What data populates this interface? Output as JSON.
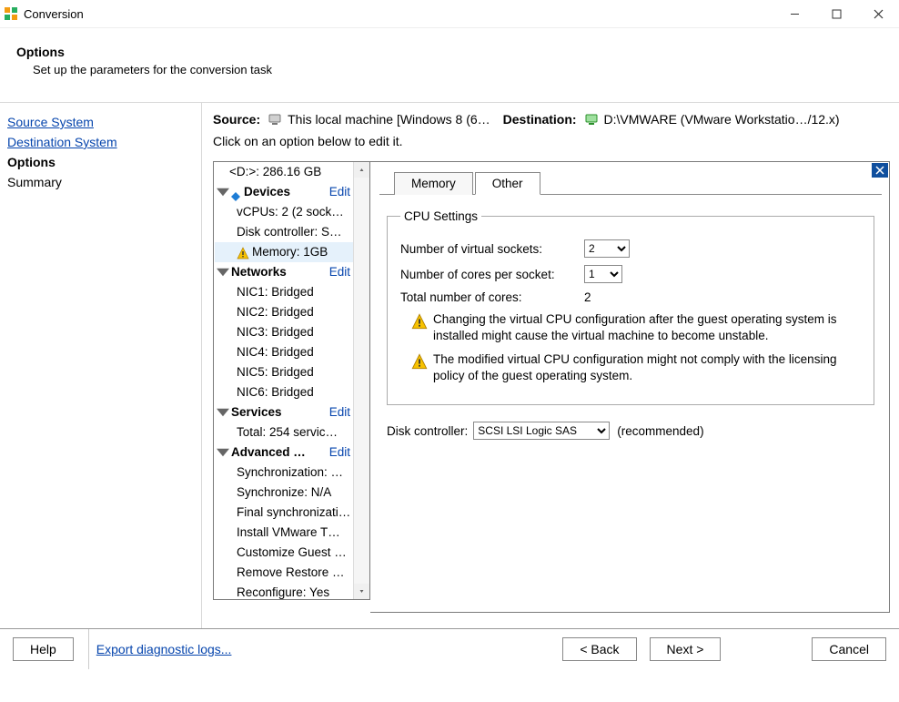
{
  "window": {
    "title": "Conversion"
  },
  "header": {
    "title": "Options",
    "subtitle": "Set up the parameters for the conversion task"
  },
  "wizard": {
    "source_link": "Source System",
    "dest_link": "Destination System",
    "options_label": "Options",
    "summary_label": "Summary"
  },
  "info": {
    "source_label": "Source:",
    "source_value": "This local machine [Windows 8 (6…",
    "dest_label": "Destination:",
    "dest_value": "D:\\VMWARE (VMware Workstatio…/12.x)",
    "instruction": "Click on an option below to edit it."
  },
  "tree": {
    "top_disk": "<D:>: 286.16 GB",
    "devices": {
      "label": "Devices",
      "edit": "Edit",
      "vcpus": "vCPUs: 2 (2 sock…",
      "disk_controller": "Disk controller: S…",
      "memory": "Memory: 1GB"
    },
    "networks": {
      "label": "Networks",
      "edit": "Edit",
      "items": [
        "NIC1: Bridged",
        "NIC2: Bridged",
        "NIC3: Bridged",
        "NIC4: Bridged",
        "NIC5: Bridged",
        "NIC6: Bridged"
      ]
    },
    "services": {
      "label": "Services",
      "edit": "Edit",
      "total": "Total: 254 servic…"
    },
    "advanced": {
      "label": "Advanced …",
      "edit": "Edit",
      "items": [
        "Synchronization: …",
        "Synchronize: N/A",
        "Final synchronizati…",
        "Install VMware T…",
        "Customize Guest …",
        "Remove Restore …",
        "Reconfigure: Yes"
      ]
    }
  },
  "tabs": {
    "memory": "Memory",
    "other": "Other"
  },
  "cpu": {
    "legend": "CPU Settings",
    "sockets_label": "Number of virtual sockets:",
    "sockets_value": "2",
    "cores_label": "Number of cores per socket:",
    "cores_value": "1",
    "total_label": "Total number of cores:",
    "total_value": "2",
    "warn1": "Changing the virtual CPU configuration after the guest operating system is installed might cause the virtual machine to become unstable.",
    "warn2": "The modified virtual CPU configuration might not comply with the licensing policy of the guest operating system."
  },
  "disk": {
    "label": "Disk controller:",
    "value": "SCSI LSI Logic SAS",
    "recommended": "(recommended)"
  },
  "footer": {
    "help": "Help",
    "diag": "Export diagnostic logs...",
    "back": "< Back",
    "next": "Next >",
    "cancel": "Cancel"
  }
}
